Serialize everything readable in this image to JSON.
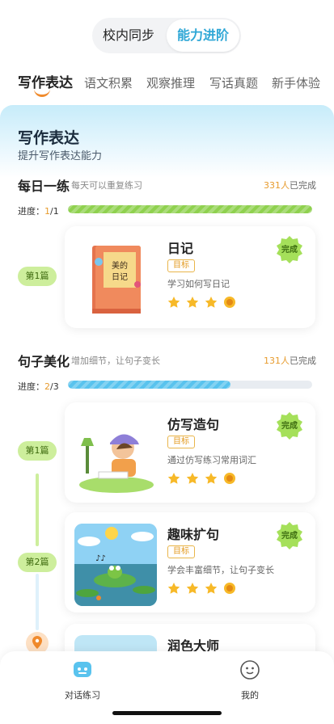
{
  "segmented": {
    "options": [
      "校内同步",
      "能力进阶"
    ],
    "selected": "能力进阶"
  },
  "tabs": [
    "写作表达",
    "语文积累",
    "观察推理",
    "写话真题",
    "新手体验"
  ],
  "hero": {
    "title": "写作表达",
    "subtitle": "提升写作表达能力"
  },
  "section1": {
    "title": "每日一练",
    "subtitle": "每天可以重复练习",
    "count": "331人",
    "count_suffix": "已完成",
    "progress_label": "进度：",
    "progress_current": "1",
    "progress_total": "/1",
    "progress": 1.0,
    "card": {
      "pill": "第1篇",
      "title": "日记",
      "tag": "目标",
      "desc": "学习如何写日记",
      "badge": "完成",
      "stars": 3
    }
  },
  "section2": {
    "title": "句子美化",
    "subtitle": "增加细节，让句子变长",
    "count": "131人",
    "count_suffix": "已完成",
    "progress_label": "进度：",
    "progress_current": "2",
    "progress_total": "/3",
    "progress": 0.667,
    "cards": [
      {
        "pill": "第1篇",
        "title": "仿写造句",
        "tag": "目标",
        "desc": "通过仿写练习常用词汇",
        "badge": "完成",
        "stars": 3
      },
      {
        "pill": "第2篇",
        "title": "趣味扩句",
        "tag": "目标",
        "desc": "学会丰富细节，让句子变长",
        "badge": "完成",
        "stars": 3
      },
      {
        "title": "润色大师"
      }
    ]
  },
  "bottom_nav": [
    {
      "label": "对话练习",
      "icon": "chat-practice-icon"
    },
    {
      "label": "我的",
      "icon": "profile-icon"
    }
  ],
  "colors": {
    "accent_blue": "#2fa7d6",
    "accent_orange": "#f08a2c",
    "progress_green": "#8fd14f",
    "progress_blue": "#59c3ee",
    "pill_green": "#cdee9c"
  }
}
